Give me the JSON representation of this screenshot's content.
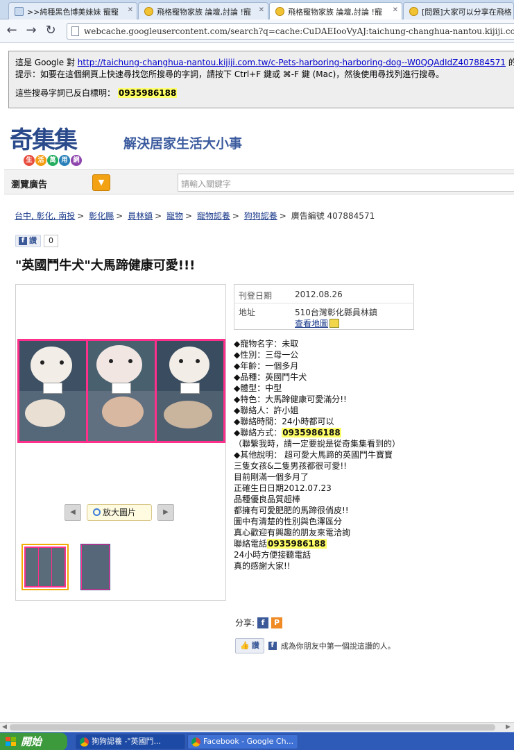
{
  "browser": {
    "tabs": [
      {
        "label": ">>純種黑色博美妹妹 寵寵",
        "icon": "page-icon"
      },
      {
        "label": "飛格寵物家族 論壇,討論 !寵",
        "icon": "paw-icon"
      },
      {
        "label": "飛格寵物家族 論壇,討論 !寵",
        "icon": "paw-icon"
      },
      {
        "label": "[問題]大家可以分享在飛格",
        "icon": "paw-icon"
      }
    ],
    "url": "webcache.googleusercontent.com/search?q=cache:CuDAEIooVyAJ:taichung-changhua-nantou.kijiji.com.tw/c-"
  },
  "cache_notice": {
    "line1_prefix": "這是 Google 對",
    "line1_link": "http://taichung-changhua-nantou.kijiji.com.tw/c-Pets-harboring-harboring-dog--W0QQAdIdZ407884571",
    "line1_suffix": "的快取",
    "line2": "提示：如要在這個網頁上快速尋找您所搜尋的字詞，請按下 Ctrl+F 鍵或 ⌘-F 鍵 (Mac)，然後使用尋找列進行搜尋。",
    "line3_prefix": "這些搜尋字詞已反白標明：",
    "search_term": "0935986188"
  },
  "site": {
    "logo_text": "奇集集",
    "logo_sub": [
      "生",
      "活",
      "萬",
      "用",
      "網"
    ],
    "slogan": "解決居家生活大小事",
    "browse_label": "瀏覽廣告",
    "search_placeholder": "請輸入關鍵字"
  },
  "breadcrumb": {
    "items": [
      "台中, 彰化, 南投",
      "彰化縣",
      "員林鎮",
      "寵物",
      "寵物認養",
      "狗狗認養"
    ],
    "ad_number": "廣告編號 407884571"
  },
  "like": {
    "label": "讚",
    "count": "0"
  },
  "ad": {
    "title": "\"英國鬥牛犬\"大馬蹄健康可愛!!!",
    "zoom_label": "放大圖片",
    "posted_label": "刊登日期",
    "posted_value": "2012.08.26",
    "address_label": "地址",
    "address_value": "510台灣彰化縣員林鎮",
    "map_link": "查看地圖",
    "desc_before": [
      "◆寵物名字：未取",
      "◆性別：三母一公",
      "◆年齡：一個多月",
      "◆品種：英國鬥牛犬",
      "◆體型：中型",
      "◆特色：大馬蹄健康可愛滿分!!",
      "◆聯絡人：許小姐",
      "◆聯絡時間：24小時都可以"
    ],
    "contact_label": "◆聯絡方式：",
    "contact_phone": "0935986188",
    "desc_after": [
      "（聯繫我時，請一定要說是從奇集集看到的）",
      "◆其他說明： 超可愛大馬蹄的英國鬥牛寶寶",
      "三隻女孩&二隻男孩都很可愛!!",
      "目前剛滿一個多月了",
      "正確生日日期2012.07.23",
      "品種優良品質超棒",
      "都擁有可愛肥肥的馬蹄很俏皮!!",
      "圖中有清楚的性別與色澤區分",
      "真心歡迎有興趣的朋友來電洽詢"
    ],
    "phone_label": "聯絡電話",
    "phone_value": "0935986188",
    "desc_end": [
      "24小時方便接聽電話",
      "真的感謝大家!!"
    ]
  },
  "share": {
    "label": "分享:",
    "fb_like_label": "讚",
    "fb_text": "成為你朋友中第一個說這讚的人。"
  },
  "taskbar": {
    "start_label": "開始",
    "tasks": [
      "狗狗認養 -\"英國鬥...",
      "Facebook - Google Ch..."
    ]
  }
}
